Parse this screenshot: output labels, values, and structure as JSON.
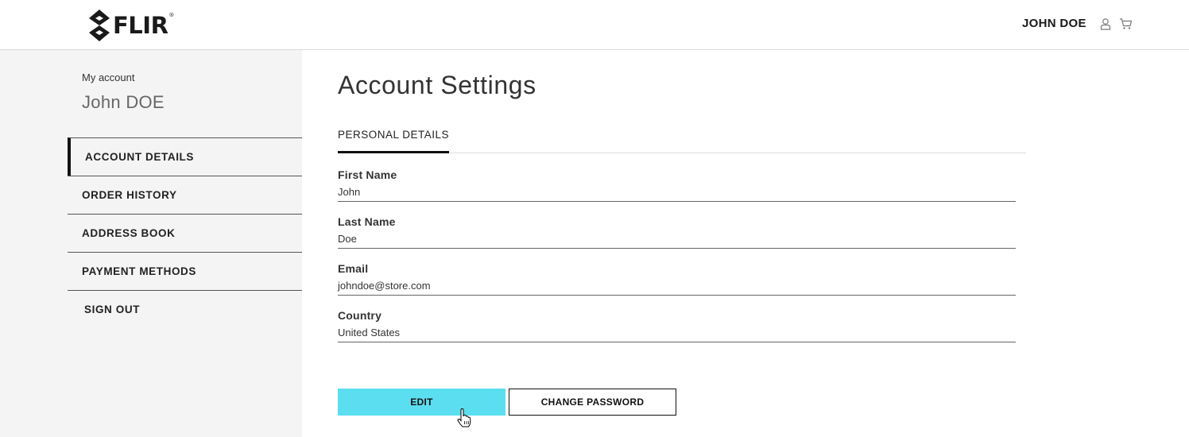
{
  "header": {
    "brand": "FLIR",
    "brand_mark": "®",
    "user_name": "JOHN DOE",
    "icons": [
      "user-icon",
      "cart-icon",
      "flir-diamond-logo"
    ]
  },
  "sidebar": {
    "kicker": "My account",
    "name": "John DOE",
    "items": [
      {
        "label": "ACCOUNT DETAILS",
        "active": true
      },
      {
        "label": "ORDER HISTORY"
      },
      {
        "label": "ADDRESS BOOK"
      },
      {
        "label": "PAYMENT METHODS"
      },
      {
        "label": "SIGN OUT"
      }
    ]
  },
  "main": {
    "title": "Account Settings",
    "tab": "PERSONAL DETAILS",
    "fields": [
      {
        "label": "First Name",
        "value": "John"
      },
      {
        "label": "Last Name",
        "value": "Doe"
      },
      {
        "label": "Email",
        "value": "johndoe@store.com"
      },
      {
        "label": "Country",
        "value": "United States"
      }
    ],
    "buttons": {
      "edit": "EDIT",
      "change_password": "CHANGE PASSWORD"
    }
  },
  "colors": {
    "accent": "#5bdef0",
    "sidebar_bg": "#f4f4f4",
    "text_dark": "#222222"
  }
}
